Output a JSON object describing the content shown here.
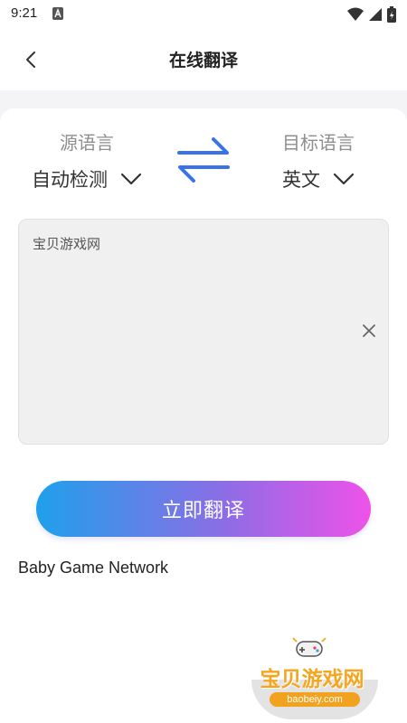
{
  "status_bar": {
    "time": "9:21",
    "left_icons": [
      "a-notification-icon"
    ],
    "right_icons": [
      "wifi-icon",
      "signal-icon",
      "battery-icon"
    ]
  },
  "header": {
    "title": "在线翻译",
    "back_icon": "chevron-left-icon"
  },
  "languages": {
    "source_label": "源语言",
    "source_value": "自动检测",
    "target_label": "目标语言",
    "target_value": "英文",
    "swap_icon": "swap-arrows-icon",
    "accent_color": "#3a72e8"
  },
  "input": {
    "value": "宝贝游戏网",
    "clear_icon": "close-icon"
  },
  "translate_button": {
    "label": "立即翻译",
    "gradient": [
      "#1fa0ea",
      "#8a6ee6",
      "#ee52e8"
    ]
  },
  "result": {
    "text": "Baby Game Network"
  },
  "watermark": {
    "title": "宝贝游戏网",
    "url": "baobeiy.com",
    "color": "#f6a51e"
  }
}
